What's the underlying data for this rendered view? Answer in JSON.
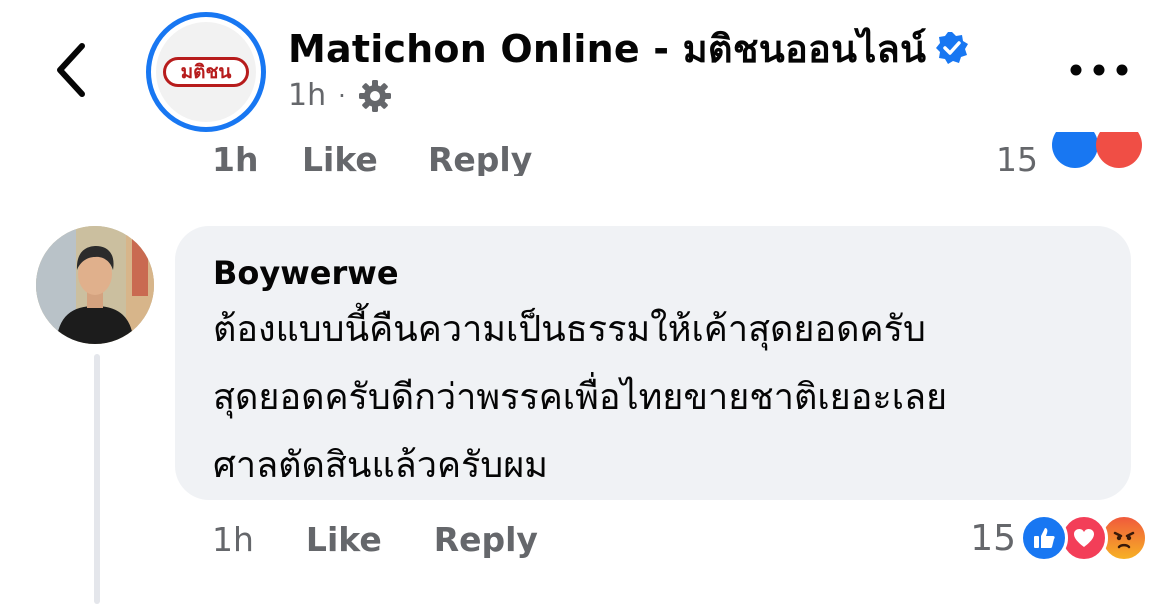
{
  "header": {
    "page_name": "Matichon Online - มติชนออนไลน์",
    "logo_text": "มติชน",
    "time": "1h",
    "separator": "·"
  },
  "previous_comment_actions": {
    "time": "1h",
    "like": "Like",
    "reply": "Reply",
    "count": "15"
  },
  "comment": {
    "author": "Boywerwe",
    "lines": [
      "ต้องแบบนี้คืนความเป็นธรรมให้เค้าสุดยอดครับ",
      "สุดยอดครับดีกว่าพรรคเพื่อไทยขายชาติเยอะเลย",
      "ศาลตัดสินแล้วครับผม"
    ],
    "time": "1h",
    "like_label": "Like",
    "reply_label": "Reply",
    "reaction_count": "15",
    "reactions": [
      "like-reaction",
      "love-reaction",
      "angry-reaction"
    ]
  },
  "colors": {
    "accent": "#1877f2",
    "secondary_text": "#65676b",
    "bubble": "#f0f2f5"
  }
}
